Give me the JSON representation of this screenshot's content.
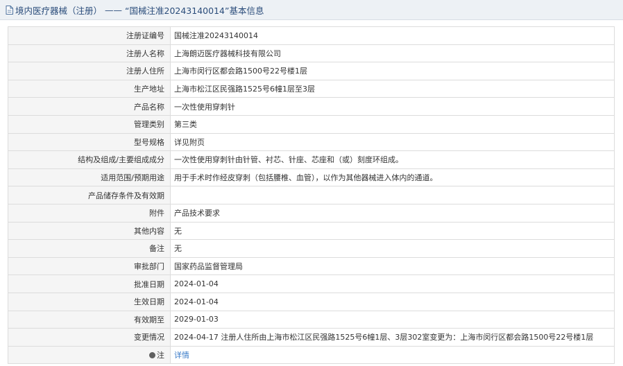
{
  "header": {
    "icon": "document-icon",
    "category": "境内医疗器械（注册）",
    "separator": "——",
    "title": "“国械注准20243140014”基本信息",
    "color": "#2a4c7a"
  },
  "rows": [
    {
      "label": "注册证编号",
      "value": "国械注准20243140014"
    },
    {
      "label": "注册人名称",
      "value": "上海朗迈医疗器械科技有限公司"
    },
    {
      "label": "注册人住所",
      "value": "上海市闵行区都会路1500号22号楼1层"
    },
    {
      "label": "生产地址",
      "value": "上海市松江区民强路1525号6幢1层至3层"
    },
    {
      "label": "产品名称",
      "value": "一次性使用穿刺针"
    },
    {
      "label": "管理类别",
      "value": "第三类"
    },
    {
      "label": "型号规格",
      "value": "详见附页"
    },
    {
      "label": "结构及组成/主要组成成分",
      "value": "一次性使用穿刺针由针管、衬芯、针座、芯座和（或）刻度环组成。"
    },
    {
      "label": "适用范围/预期用途",
      "value": "用于手术时作经皮穿刺（包括腰椎、血管），以作为其他器械进入体内的通道。"
    },
    {
      "label": "产品储存条件及有效期",
      "value": ""
    },
    {
      "label": "附件",
      "value": "产品技术要求"
    },
    {
      "label": "其他内容",
      "value": "无"
    },
    {
      "label": "备注",
      "value": "无"
    },
    {
      "label": "审批部门",
      "value": "国家药品监督管理局"
    },
    {
      "label": "批准日期",
      "value": "2024-01-04"
    },
    {
      "label": "生效日期",
      "value": "2024-01-04"
    },
    {
      "label": "有效期至",
      "value": "2029-01-03"
    },
    {
      "label": "变更情况",
      "value": "2024-04-17 注册人住所由上海市松江区民强路1525号6幢1层、3层302室变更为：上海市闵行区都会路1500号22号楼1层"
    }
  ],
  "note_row": {
    "icon": "info-dot-icon",
    "label": "注",
    "link_text": "详情",
    "link_color": "#3a7bc8"
  }
}
